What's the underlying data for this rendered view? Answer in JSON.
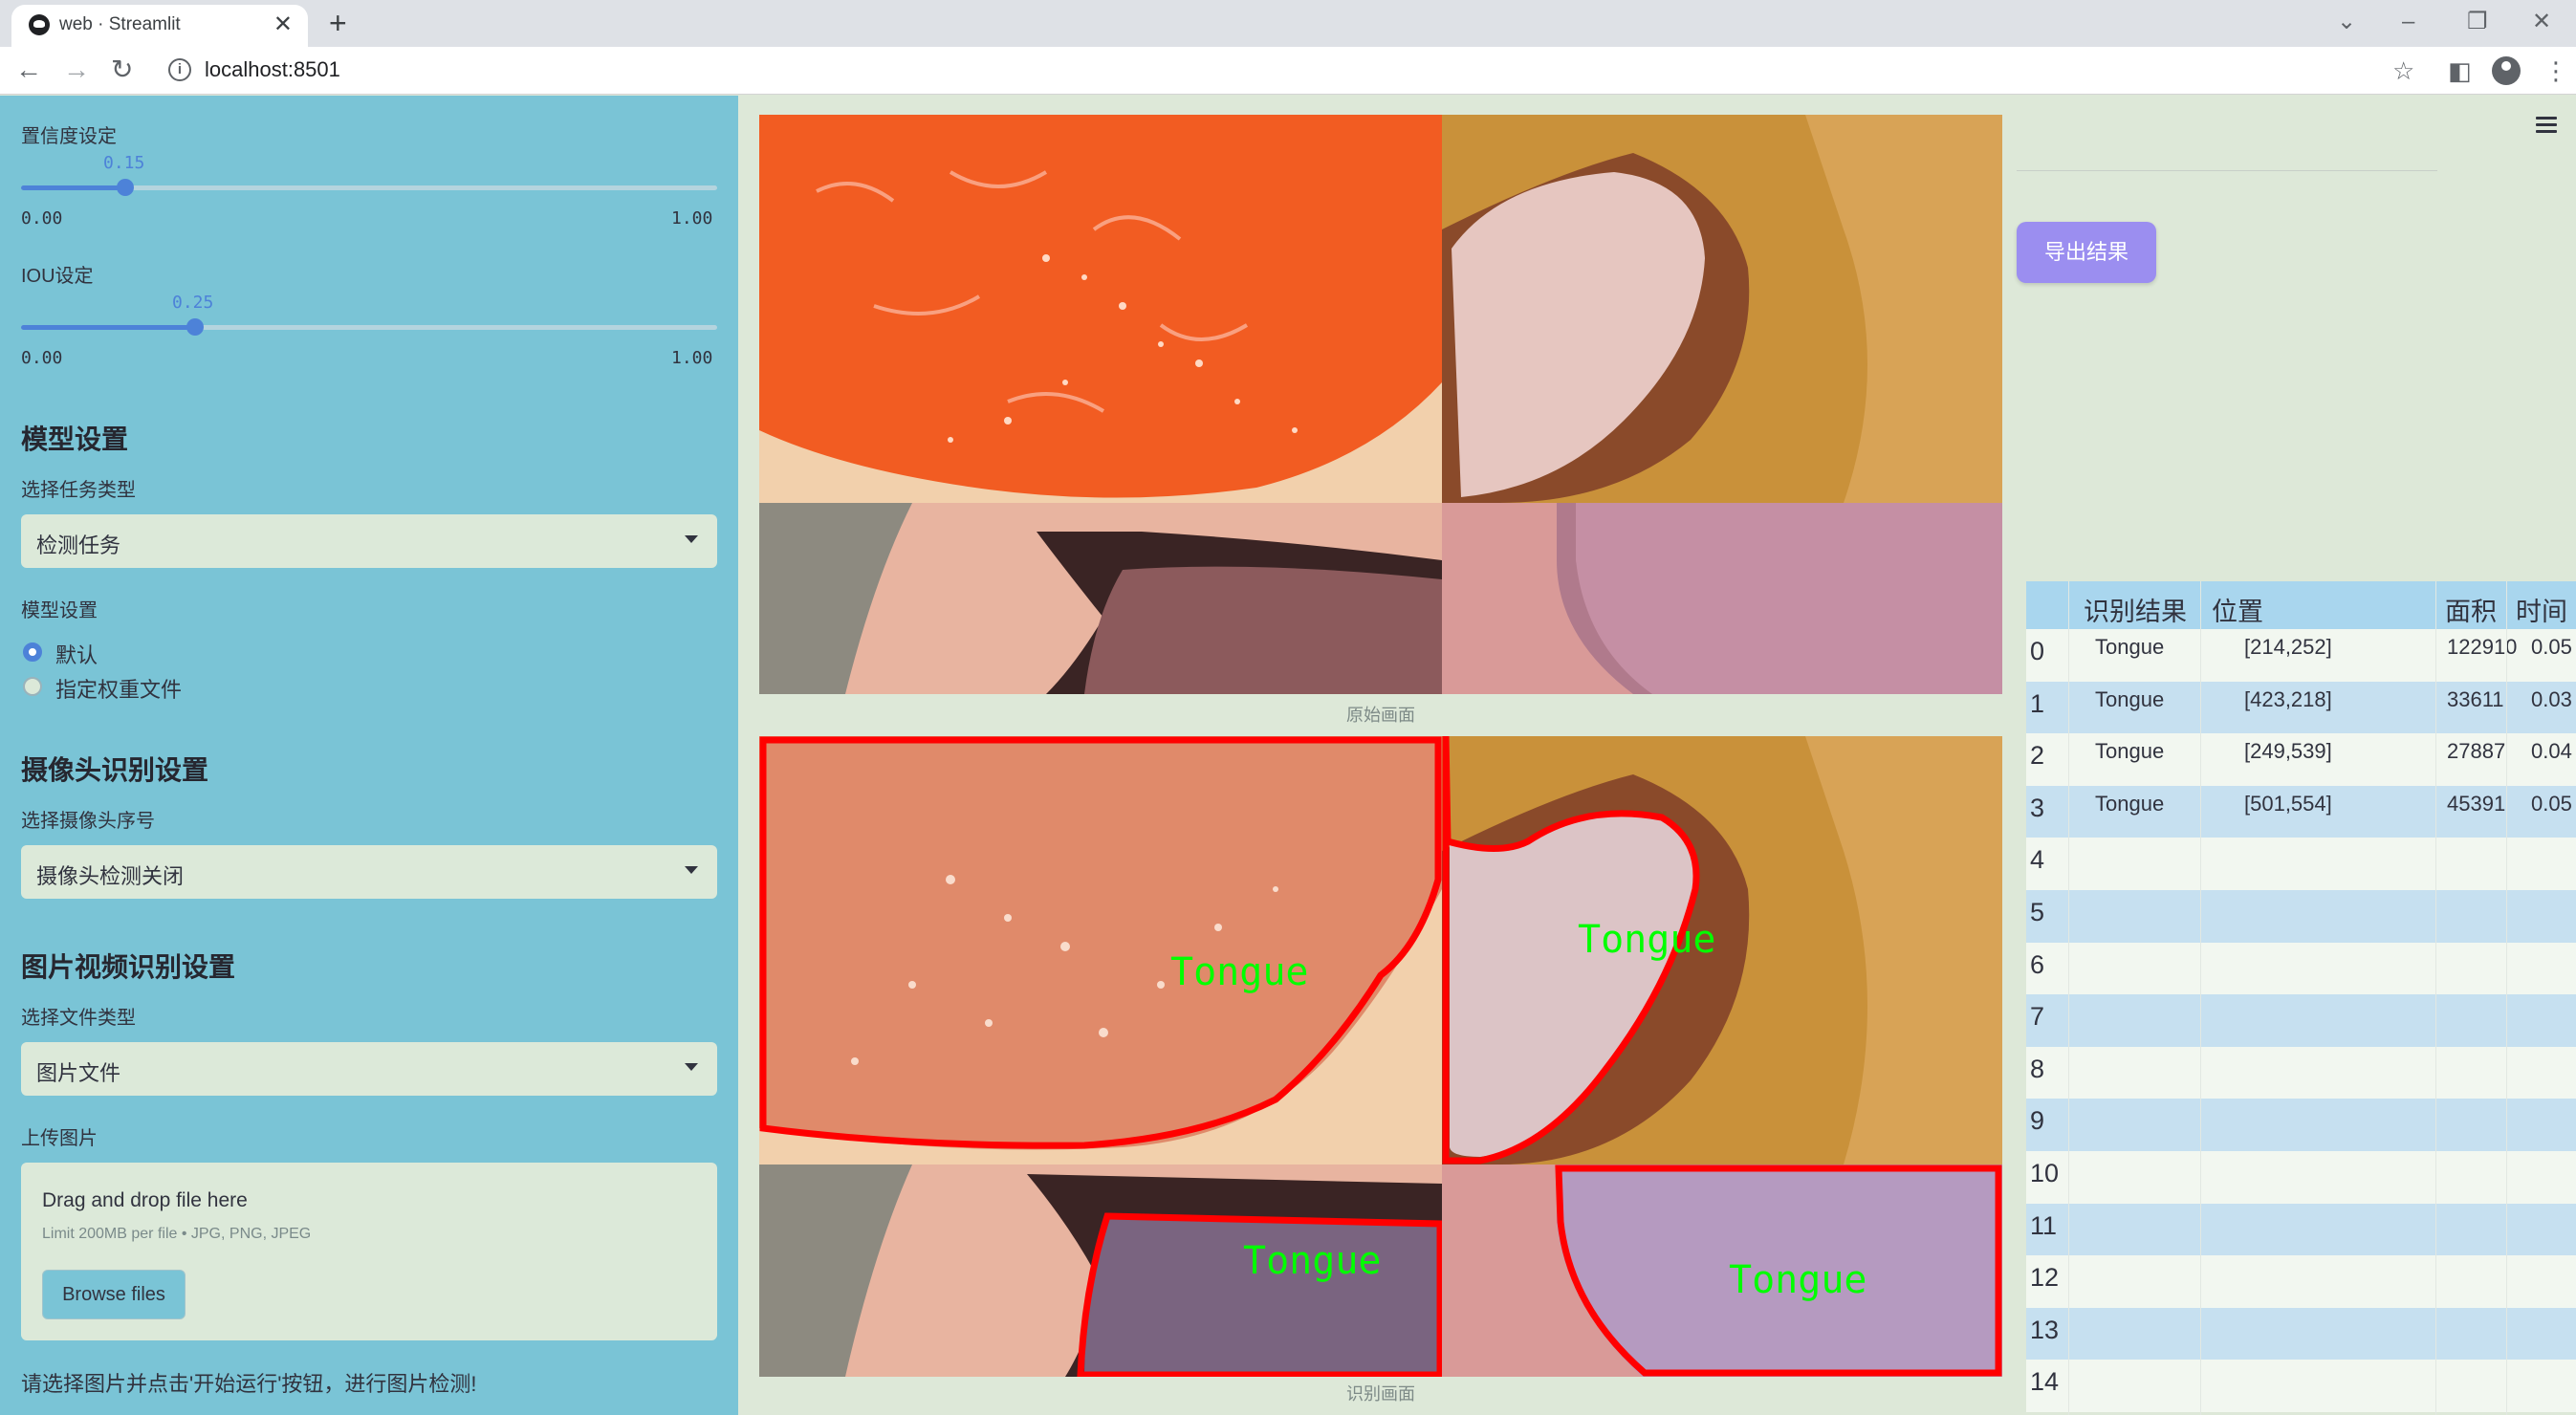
{
  "browser": {
    "tab_title": "web · Streamlit",
    "url": "localhost:8501"
  },
  "sidebar": {
    "confidence": {
      "label": "置信度设定",
      "value": "0.15",
      "min": "0.00",
      "max": "1.00",
      "fraction": 0.15
    },
    "iou": {
      "label": "IOU设定",
      "value": "0.25",
      "min": "0.00",
      "max": "1.00",
      "fraction": 0.25
    },
    "model_section": "模型设置",
    "task_label": "选择任务类型",
    "task_value": "检测任务",
    "model_label": "模型设置",
    "radio_default": "默认",
    "radio_custom": "指定权重文件",
    "camera_section": "摄像头识别设置",
    "camera_label": "选择摄像头序号",
    "camera_value": "摄像头检测关闭",
    "media_section": "图片视频识别设置",
    "filetype_label": "选择文件类型",
    "filetype_value": "图片文件",
    "upload_label": "上传图片",
    "upload_title": "Drag and drop file here",
    "upload_limit": "Limit 200MB per file • JPG, PNG, JPEG",
    "browse_label": "Browse files",
    "hint": "请选择图片并点击'开始运行'按钮，进行图片检测!"
  },
  "main": {
    "original_caption": "原始画面",
    "result_caption": "识别画面",
    "detection_label": "Tongue",
    "export_label": "导出结果"
  },
  "table": {
    "headers": [
      "识别结果",
      "位置",
      "面积",
      "时间"
    ],
    "rows": [
      {
        "idx": "0",
        "result": "Tongue",
        "pos": "[214,252]",
        "area": "122910",
        "time": "0.05"
      },
      {
        "idx": "1",
        "result": "Tongue",
        "pos": "[423,218]",
        "area": "33611",
        "time": "0.03"
      },
      {
        "idx": "2",
        "result": "Tongue",
        "pos": "[249,539]",
        "area": "27887",
        "time": "0.04"
      },
      {
        "idx": "3",
        "result": "Tongue",
        "pos": "[501,554]",
        "area": "45391",
        "time": "0.05"
      },
      {
        "idx": "4"
      },
      {
        "idx": "5"
      },
      {
        "idx": "6"
      },
      {
        "idx": "7"
      },
      {
        "idx": "8"
      },
      {
        "idx": "9"
      },
      {
        "idx": "10"
      },
      {
        "idx": "11"
      },
      {
        "idx": "12"
      },
      {
        "idx": "13"
      },
      {
        "idx": "14"
      }
    ]
  },
  "colors": {
    "sidebar": "#7ac4d6",
    "main": "#dde8d8",
    "accent": "#4d82d8",
    "export": "#9b8ef0",
    "box": "#ff0000",
    "label": "#00ff00"
  }
}
